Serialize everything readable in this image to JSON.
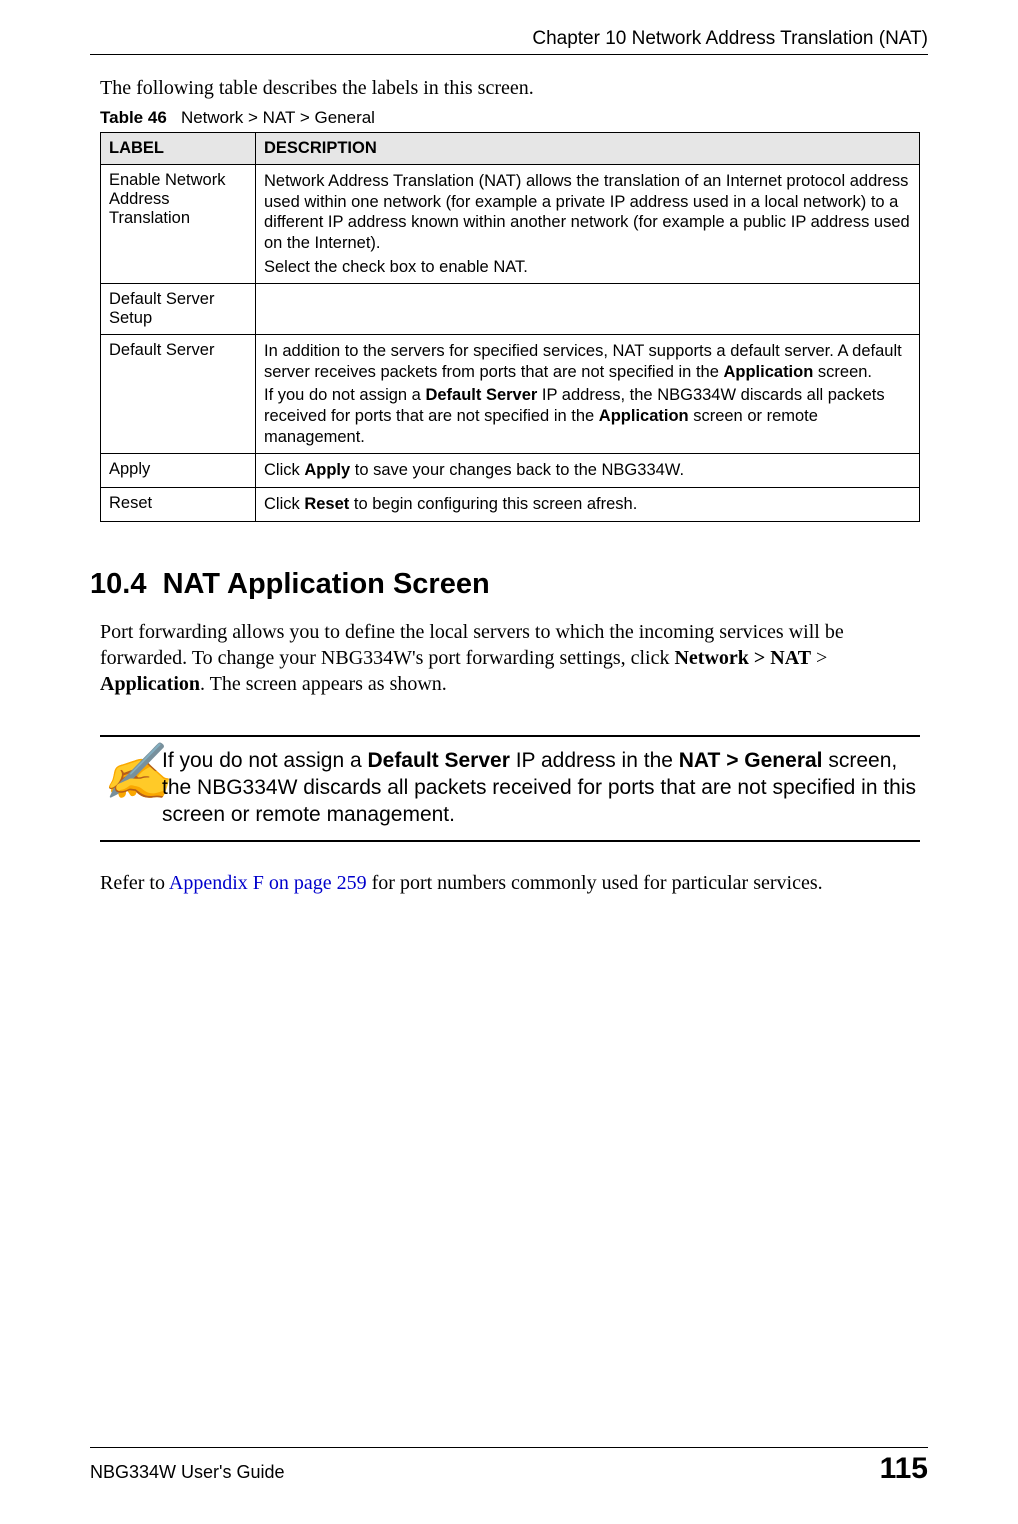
{
  "header": {
    "chapter": "Chapter 10 Network Address Translation (NAT)"
  },
  "intro": "The following table describes the labels in this screen.",
  "table": {
    "caption_prefix": "Table 46",
    "caption_rest": "Network > NAT > General",
    "head_label": "LABEL",
    "head_desc": "DESCRIPTION",
    "rows": [
      {
        "label": "Enable Network Address Translation",
        "desc_p1": "Network Address Translation (NAT) allows the translation of an Internet protocol address used within one network (for example a private IP address used in a local network) to a different IP address known within another network (for example a public IP address used on the Internet).",
        "desc_p2": "Select the check box to enable NAT."
      },
      {
        "label": "Default Server Setup",
        "desc_p1": ""
      },
      {
        "label": "Default Server",
        "desc_p1a": "In addition to the servers for specified services, NAT supports a default server. A default server receives packets from ports that are not specified in the ",
        "desc_p1b": "Application",
        "desc_p1c": " screen.",
        "desc_p2a": "If you do not assign a ",
        "desc_p2b": "Default Server",
        "desc_p2c": " IP address, the NBG334W discards all packets received for ports that are not specified in the ",
        "desc_p2d": "Application",
        "desc_p2e": " screen or remote management."
      },
      {
        "label": "Apply",
        "desc_a": "Click ",
        "desc_b": "Apply",
        "desc_c": " to save your changes back to the NBG334W."
      },
      {
        "label": "Reset",
        "desc_a": "Click ",
        "desc_b": "Reset",
        "desc_c": " to begin configuring this screen afresh."
      }
    ]
  },
  "section": {
    "number": "10.4",
    "title": "NAT Application Screen"
  },
  "body": {
    "p1a": "Port forwarding allows you to define the local servers to which the incoming services will be forwarded. To change your NBG334W's port forwarding settings, click ",
    "p1b": "Network > NAT",
    "p1c": " > ",
    "p1d": "Application",
    "p1e": ". The screen appears as shown."
  },
  "note": {
    "icon": "✍",
    "t1": "If you do not assign a ",
    "t2": "Default Server",
    "t3": " IP address in the ",
    "t4": "NAT > General",
    "t5": " screen, the NBG334W discards all packets received for ports that are not specified in this screen or remote management."
  },
  "refer": {
    "a": "Refer to ",
    "b": "Appendix F on page 259",
    "c": " for port numbers commonly used for particular services."
  },
  "footer": {
    "left": "NBG334W User's Guide",
    "right": "115"
  }
}
